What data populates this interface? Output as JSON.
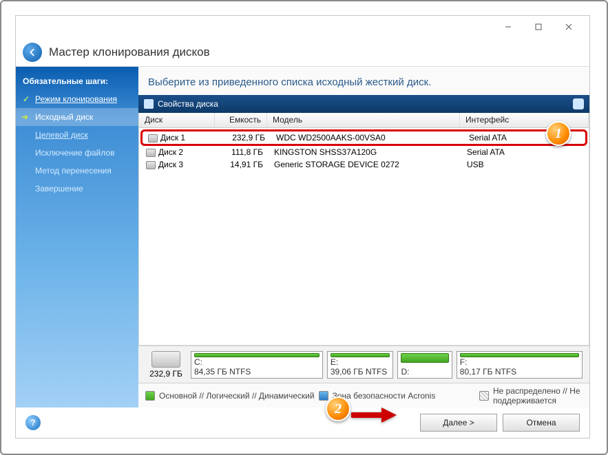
{
  "window": {
    "title": "Мастер клонирования дисков"
  },
  "sidebar": {
    "heading": "Обязательные шаги:",
    "items": [
      {
        "label": "Режим клонирования",
        "state": "done"
      },
      {
        "label": "Исходный диск",
        "state": "current"
      },
      {
        "label": "Целевой диск",
        "state": "upcoming"
      },
      {
        "label": "Исключение файлов",
        "state": "upcoming"
      },
      {
        "label": "Метод перенесения",
        "state": "upcoming"
      },
      {
        "label": "Завершение",
        "state": "upcoming"
      }
    ]
  },
  "main": {
    "instruction": "Выберите из приведенного списка исходный жесткий диск.",
    "properties_bar": "Свойства диска",
    "columns": {
      "name": "Диск",
      "capacity": "Емкость",
      "model": "Модель",
      "interface": "Интерфейс"
    },
    "disks": [
      {
        "name": "Диск 1",
        "capacity": "232,9 ГБ",
        "model": "WDC WD2500AAKS-00VSA0",
        "interface": "Serial ATA",
        "selected": true
      },
      {
        "name": "Диск 2",
        "capacity": "111,8 ГБ",
        "model": "KINGSTON SHSS37A120G",
        "interface": "Serial ATA",
        "selected": false
      },
      {
        "name": "Диск 3",
        "capacity": "14,91 ГБ",
        "model": "Generic STORAGE DEVICE 0272",
        "interface": "USB",
        "selected": false
      }
    ],
    "layout": {
      "total": "232,9 ГБ",
      "parts": [
        {
          "letter": "C:",
          "info": "84,35 ГБ  NTFS"
        },
        {
          "letter": "E:",
          "info": "39,06 ГБ  NTFS"
        },
        {
          "letter": "D:",
          "info": ""
        },
        {
          "letter": "F:",
          "info": "80,17 ГБ  NTFS"
        }
      ]
    },
    "legend": {
      "primary": "Основной // Логический // Динамический",
      "acronis": "Зона безопасности Acronis",
      "unalloc": "Не распределено // Не поддерживается"
    }
  },
  "footer": {
    "next": "Далее >",
    "cancel": "Отмена"
  },
  "callouts": {
    "one": "1",
    "two": "2"
  }
}
